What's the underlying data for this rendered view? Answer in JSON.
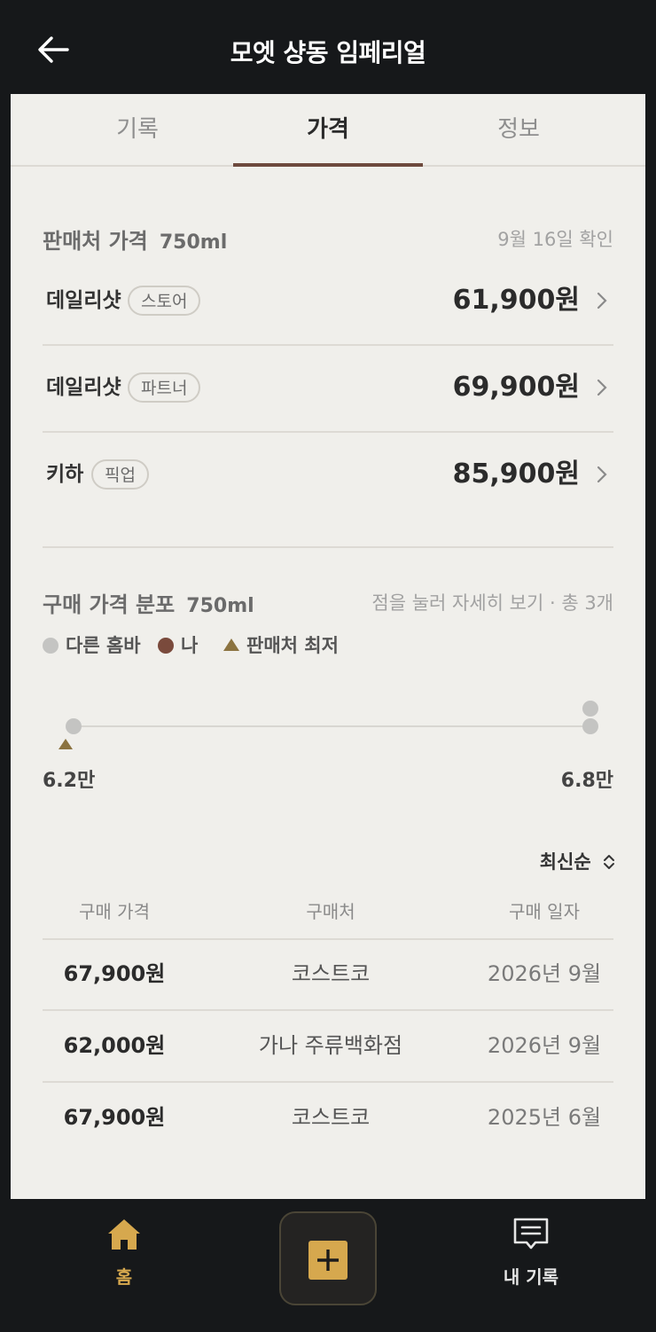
{
  "header": {
    "title": "모엣 샹동 임페리얼"
  },
  "tabs": [
    {
      "label": "기록",
      "active": false
    },
    {
      "label": "가격",
      "active": true
    },
    {
      "label": "정보",
      "active": false
    }
  ],
  "seller_section": {
    "title": "판매처 가격",
    "volume": "750ml",
    "checked": "9월 16일 확인",
    "rows": [
      {
        "name": "데일리샷",
        "tag": "스토어",
        "price": "61,900원"
      },
      {
        "name": "데일리샷",
        "tag": "파트너",
        "price": "69,900원"
      },
      {
        "name": "키하",
        "tag": "픽업",
        "price": "85,900원"
      }
    ]
  },
  "distribution": {
    "title": "구매 가격 분포",
    "volume": "750ml",
    "hint": "점을 눌러 자세히 보기 · 총 3개",
    "legend": {
      "others": "다른 홈바",
      "me": "나",
      "lowest": "판매처 최저"
    },
    "colors": {
      "others": "#c4c4c2",
      "me": "#7a4a3c",
      "lowest": "#8b7340"
    },
    "min_label": "6.2만",
    "max_label": "6.8만"
  },
  "chart_data": {
    "type": "scatter",
    "xlim": [
      62000,
      67900
    ],
    "points": [
      {
        "x": 62000,
        "stack": 0,
        "series": "others"
      },
      {
        "x": 67900,
        "stack": 0,
        "series": "others"
      },
      {
        "x": 67900,
        "stack": 1,
        "series": "others"
      }
    ],
    "markers": [
      {
        "x": 61900,
        "series": "lowest"
      }
    ]
  },
  "purchases": {
    "sort_label": "최신순",
    "headers": {
      "price": "구매 가격",
      "place": "구매처",
      "date": "구매 일자"
    },
    "rows": [
      {
        "price": "67,900원",
        "place": "코스트코",
        "date": "2026년 9월"
      },
      {
        "price": "62,000원",
        "place": "가나 주류백화점",
        "date": "2026년 9월"
      },
      {
        "price": "67,900원",
        "place": "코스트코",
        "date": "2025년 6월"
      }
    ]
  },
  "bottom_nav": {
    "home": "홈",
    "records": "내 기록",
    "colors": {
      "active": "#d6a84e",
      "inactive": "#e6e6e6"
    }
  }
}
